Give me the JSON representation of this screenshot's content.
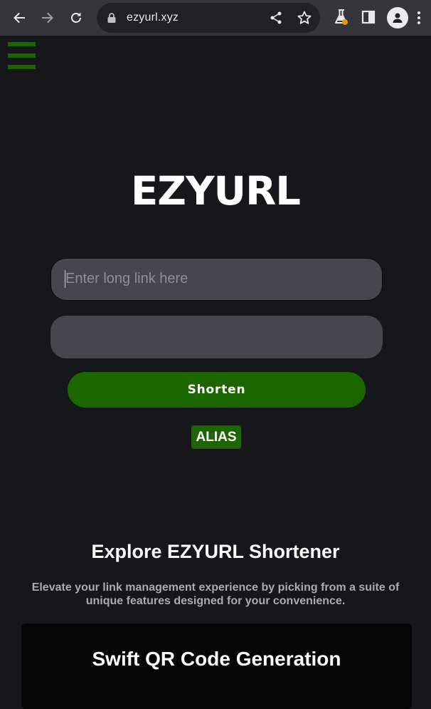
{
  "browser": {
    "url": "ezyurl.xyz",
    "icons": [
      "back-icon",
      "forward-icon",
      "reload-icon",
      "lock-icon",
      "share-icon",
      "star-icon",
      "labs-icon",
      "side-panel-icon",
      "profile-icon"
    ]
  },
  "colors": {
    "background": "#16171b",
    "accent": "#1c6600",
    "field": "#45474c",
    "card": "#050505"
  },
  "header": {
    "menu_icon": "hamburger-menu-icon"
  },
  "hero": {
    "logo": "EZYURL",
    "long_link_placeholder": "Enter long link here",
    "long_link_value": "",
    "alias_value": "",
    "shorten_label": "Shorten",
    "alias_label": "ALIAS"
  },
  "explore": {
    "title": "Explore EZYURL Shortener",
    "subtitle": "Elevate your link management experience by picking from a suite of unique features designed for your convenience."
  },
  "features": [
    {
      "title": "Swift QR Code Generation"
    }
  ]
}
